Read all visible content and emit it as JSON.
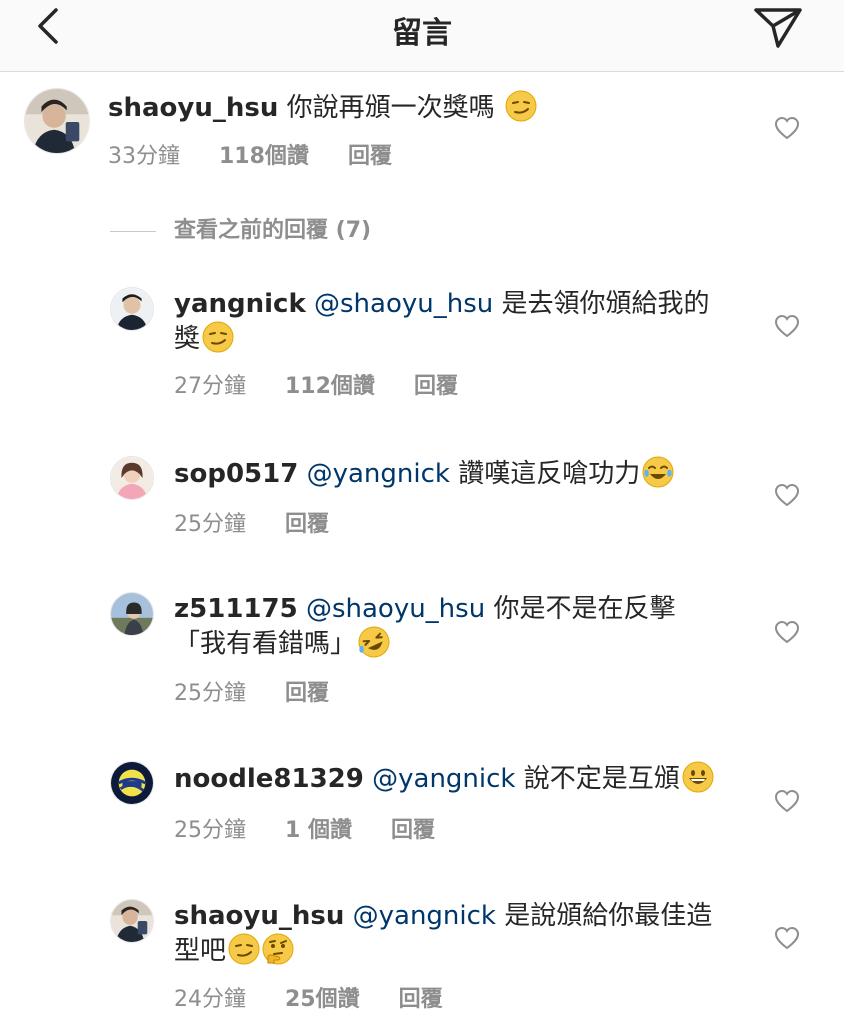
{
  "header": {
    "title": "留言"
  },
  "view_previous": "查看之前的回覆 (7)",
  "comments": [
    {
      "user": "shaoyu_hsu",
      "mention": "",
      "text": "你說再頒一次獎嗎",
      "time": "33分鐘",
      "likes": "118個讚",
      "reply": "回覆"
    },
    {
      "user": "yangnick",
      "mention": "@shaoyu_hsu",
      "text": "是去領你頒給我的獎",
      "time": "27分鐘",
      "likes": "112個讚",
      "reply": "回覆"
    },
    {
      "user": "sop0517",
      "mention": "@yangnick",
      "text": "讚嘆這反嗆功力",
      "time": "25分鐘",
      "likes": "",
      "reply": "回覆"
    },
    {
      "user": "z511175",
      "mention": "@shaoyu_hsu",
      "text": "你是不是在反擊「我有看錯嗎」",
      "time": "25分鐘",
      "likes": "",
      "reply": "回覆"
    },
    {
      "user": "noodle81329",
      "mention": "@yangnick",
      "text": "說不定是互頒",
      "time": "25分鐘",
      "likes": "1 個讚",
      "reply": "回覆"
    },
    {
      "user": "shaoyu_hsu",
      "mention": "@yangnick",
      "text": "是說頒給你最佳造型吧",
      "time": "24分鐘",
      "likes": "25個讚",
      "reply": "回覆"
    }
  ],
  "icons": {
    "back": "chevron-left-icon",
    "send": "paper-plane-icon",
    "like": "heart-outline-icon"
  }
}
